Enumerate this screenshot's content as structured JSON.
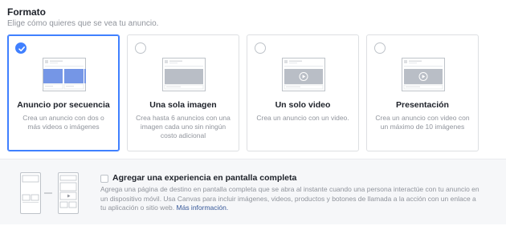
{
  "section": {
    "title": "Formato",
    "subtitle": "Elige cómo quieres que se vea tu anuncio."
  },
  "formats": [
    {
      "title": "Anuncio por secuencia",
      "description": "Crea un anuncio con dos o más videos o imágenes",
      "selected": true,
      "icon": "carousel-icon"
    },
    {
      "title": "Una sola imagen",
      "description": "Crea hasta 6 anuncios con una imagen cada uno sin ningún costo adicional",
      "selected": false,
      "icon": "single-image-icon"
    },
    {
      "title": "Un solo video",
      "description": "Crea un anuncio con un video.",
      "selected": false,
      "icon": "single-video-icon"
    },
    {
      "title": "Presentación",
      "description": "Crea un anuncio con video con un máximo de 10 imágenes",
      "selected": false,
      "icon": "slideshow-icon"
    }
  ],
  "canvas": {
    "title": "Agregar una experiencia en pantalla completa",
    "description": "Agrega una página de destino en pantalla completa que se abra al instante cuando una persona interactúe con tu anuncio en un dispositivo móvil. Usa Canvas para incluir imágenes, videos, productos y botones de llamada a la acción con un enlace a tu aplicación o sitio web.",
    "link": "Más información.",
    "checked": false
  },
  "colors": {
    "accent": "#4080ff",
    "border": "#dddfe2",
    "muted": "#90949c",
    "link": "#365899"
  }
}
